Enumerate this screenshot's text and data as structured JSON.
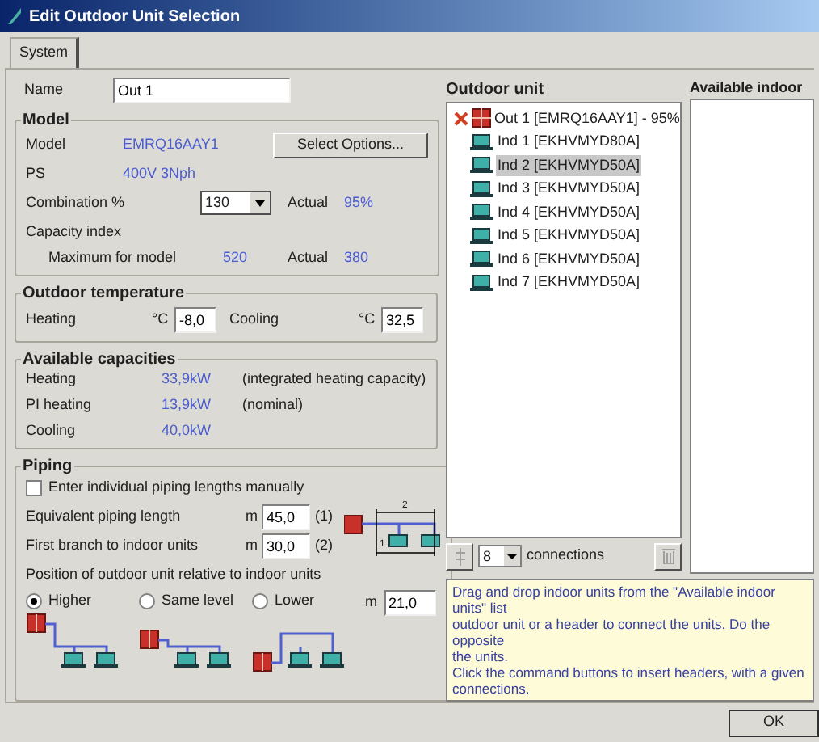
{
  "window": {
    "title": "Edit Outdoor Unit Selection"
  },
  "tabs": [
    {
      "label": "System",
      "selected": true
    }
  ],
  "name": {
    "label": "Name",
    "value": "Out 1"
  },
  "model_group": {
    "title": "Model",
    "model_label": "Model",
    "model_value": "EMRQ16AAY1",
    "select_button": "Select Options...",
    "ps_label": "PS",
    "ps_value": "400V 3Nph",
    "combination_label": "Combination %",
    "combination_value": "130",
    "combination_actual_label": "Actual",
    "combination_actual_value": "95%",
    "capacity_label": "Capacity index",
    "max_label": "Maximum for model",
    "max_value": "520",
    "actual_label": "Actual",
    "actual_value": "380"
  },
  "outdoor_temperature": {
    "title": "Outdoor temperature",
    "heating_label": "Heating",
    "heating_unit": "°C",
    "heating_value": "-8,0",
    "cooling_label": "Cooling",
    "cooling_unit": "°C",
    "cooling_value": "32,5"
  },
  "available_capacities": {
    "title": "Available capacities",
    "rows": [
      {
        "label": "Heating",
        "value": "33,9kW",
        "note": "(integrated heating capacity)"
      },
      {
        "label": "PI heating",
        "value": "13,9kW",
        "note": "(nominal)"
      },
      {
        "label": "Cooling",
        "value": "40,0kW"
      }
    ]
  },
  "piping": {
    "title": "Piping",
    "manual_checkbox": {
      "label": "Enter individual piping lengths manually",
      "checked": false
    },
    "lengths": [
      {
        "label": "Equivalent piping length",
        "unit": "m",
        "value": "45,0",
        "note": "(1)"
      },
      {
        "label": "First branch to indoor units",
        "unit": "m",
        "value": "30,0",
        "note": "(2)"
      }
    ],
    "diagram_marks": [
      "2",
      "1"
    ],
    "position_label": "Position of outdoor unit relative to indoor units",
    "positions": [
      {
        "label": "Higher",
        "kind": "higher",
        "selected": true
      },
      {
        "label": "Same level",
        "kind": "same",
        "selected": false
      },
      {
        "label": "Lower",
        "kind": "lower",
        "selected": false
      }
    ],
    "height_unit": "m",
    "height_value": "21,0"
  },
  "outdoor_unit": {
    "title": "Outdoor unit",
    "tree": {
      "label": "Out 1 [EMRQ16AAY1] - 95%",
      "children": [
        {
          "label": "Ind 1 [EKHVMYD80A]",
          "selected": false
        },
        {
          "label": "Ind 2 [EKHVMYD50A]",
          "selected": true
        },
        {
          "label": "Ind 3 [EKHVMYD50A]",
          "selected": false
        },
        {
          "label": "Ind 4 [EKHVMYD50A]",
          "selected": false
        },
        {
          "label": "Ind 5 [EKHVMYD50A]",
          "selected": false
        },
        {
          "label": "Ind 6 [EKHVMYD50A]",
          "selected": false
        },
        {
          "label": "Ind 7 [EKHVMYD50A]",
          "selected": false
        }
      ]
    },
    "connections_value": "8",
    "connections_label": "connections"
  },
  "available_indoor": {
    "title": "Available indoor"
  },
  "help_lines": [
    "Drag and drop indoor units from the \"Available indoor units\" list",
    "outdoor unit or a header to connect the units. Do the opposite",
    "the units.",
    "Click the command buttons to insert headers, with a given",
    "connections."
  ],
  "buttons": [
    "OK"
  ]
}
